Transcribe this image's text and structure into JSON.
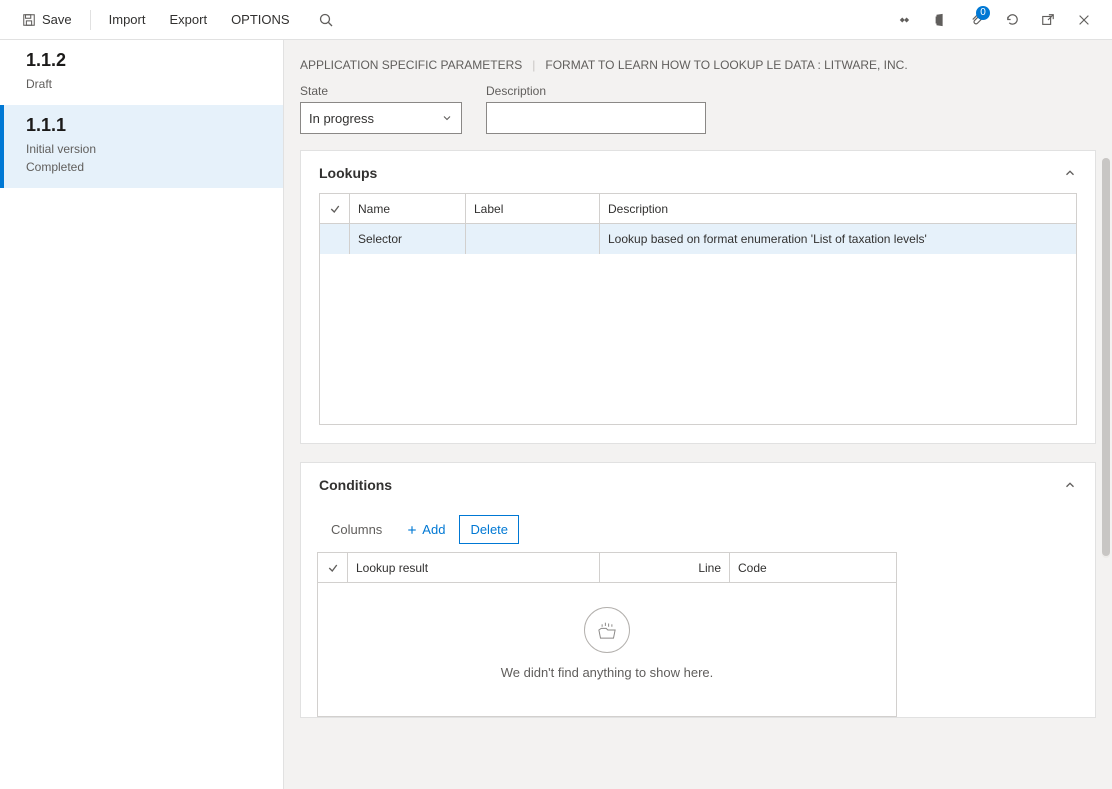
{
  "toolbar": {
    "save_label": "Save",
    "import_label": "Import",
    "export_label": "Export",
    "options_label": "OPTIONS",
    "notification_count": "0"
  },
  "sidebar": {
    "items": [
      {
        "title": "1.1.2",
        "line1": "Draft",
        "line2": ""
      },
      {
        "title": "1.1.1",
        "line1": "Initial version",
        "line2": "Completed"
      }
    ]
  },
  "breadcrumb": {
    "left": "APPLICATION SPECIFIC PARAMETERS",
    "right": "FORMAT TO LEARN HOW TO LOOKUP LE DATA : LITWARE, INC."
  },
  "fields": {
    "state_label": "State",
    "state_value": "In progress",
    "description_label": "Description",
    "description_value": ""
  },
  "lookups": {
    "title": "Lookups",
    "columns": {
      "name": "Name",
      "label": "Label",
      "description": "Description"
    },
    "rows": [
      {
        "name": "Selector",
        "label": "",
        "description": "Lookup based on format enumeration 'List of taxation levels'"
      }
    ]
  },
  "conditions": {
    "title": "Conditions",
    "toolbar": {
      "columns": "Columns",
      "add": "Add",
      "delete": "Delete"
    },
    "columns": {
      "lookup_result": "Lookup result",
      "line": "Line",
      "code": "Code"
    },
    "empty_text": "We didn't find anything to show here."
  }
}
